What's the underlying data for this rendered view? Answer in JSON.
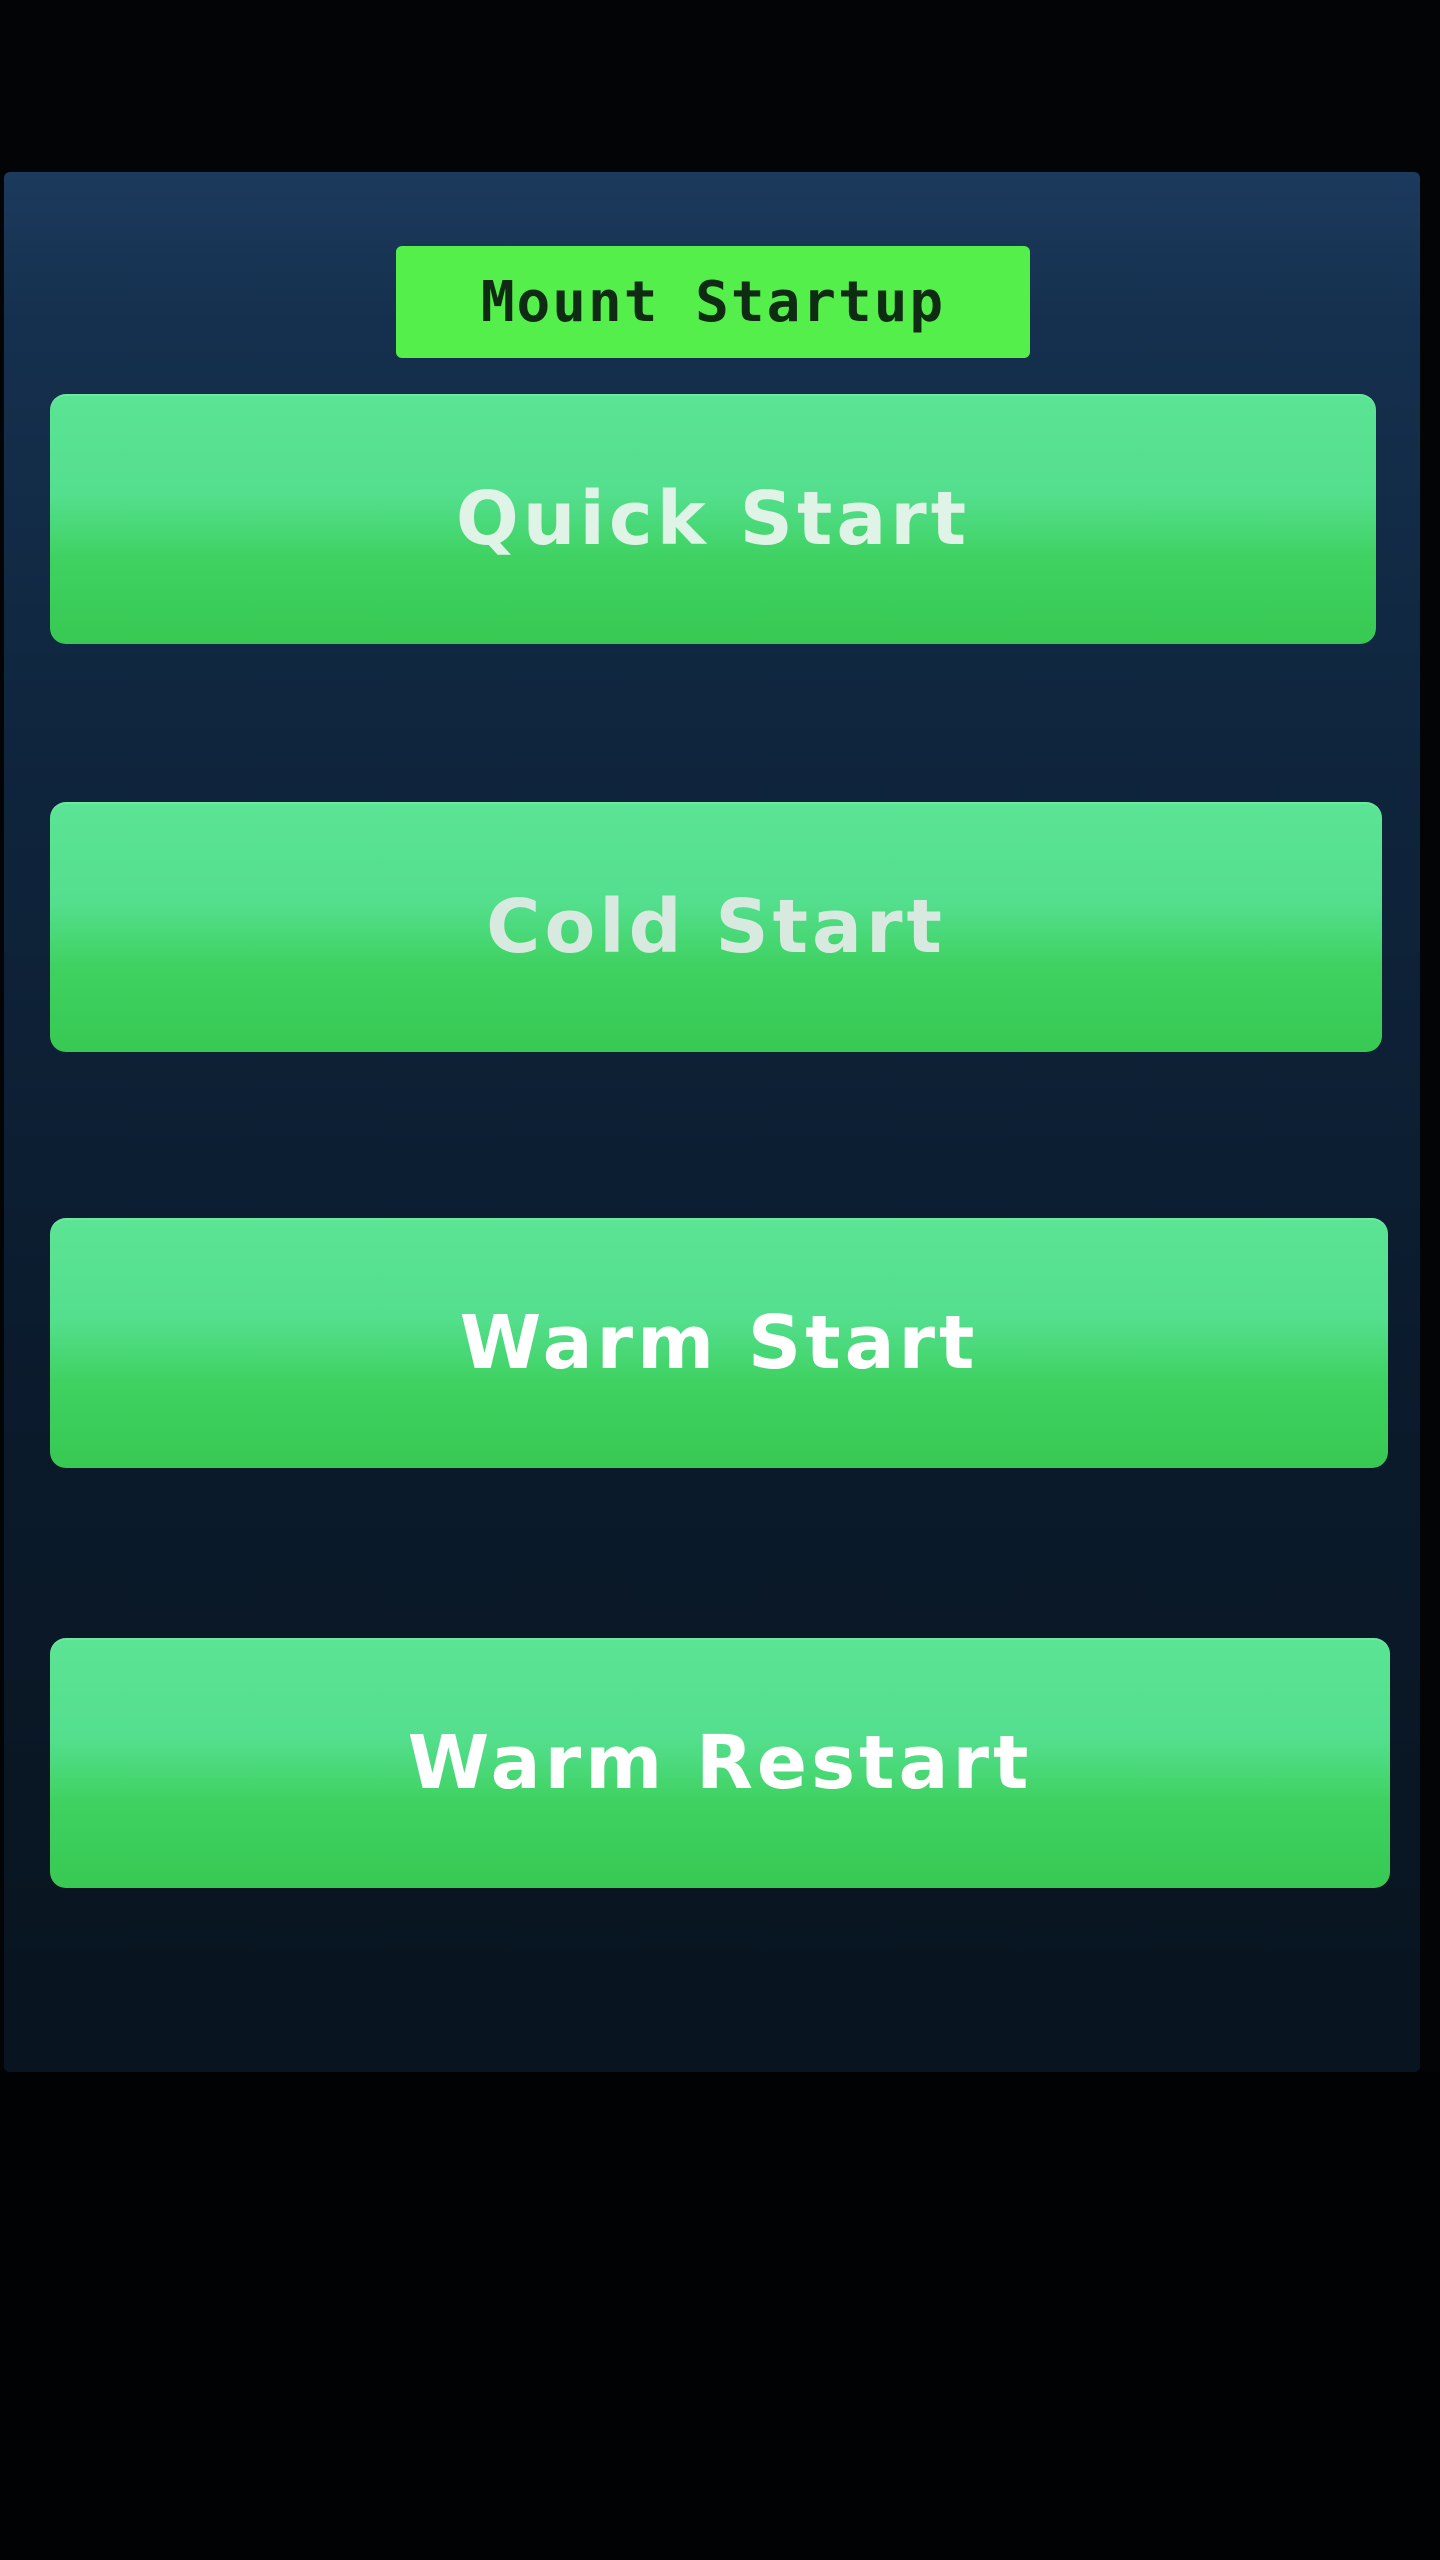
{
  "screen": {
    "title": "Mount Startup"
  },
  "buttons": {
    "quick_start": "Quick Start",
    "cold_start": "Cold Start",
    "warm_start": "Warm Start",
    "warm_restart": "Warm Restart"
  },
  "colors": {
    "title_badge": "#54ef4a",
    "button_green": "#3fd262",
    "screen_background": "#0f253d"
  }
}
